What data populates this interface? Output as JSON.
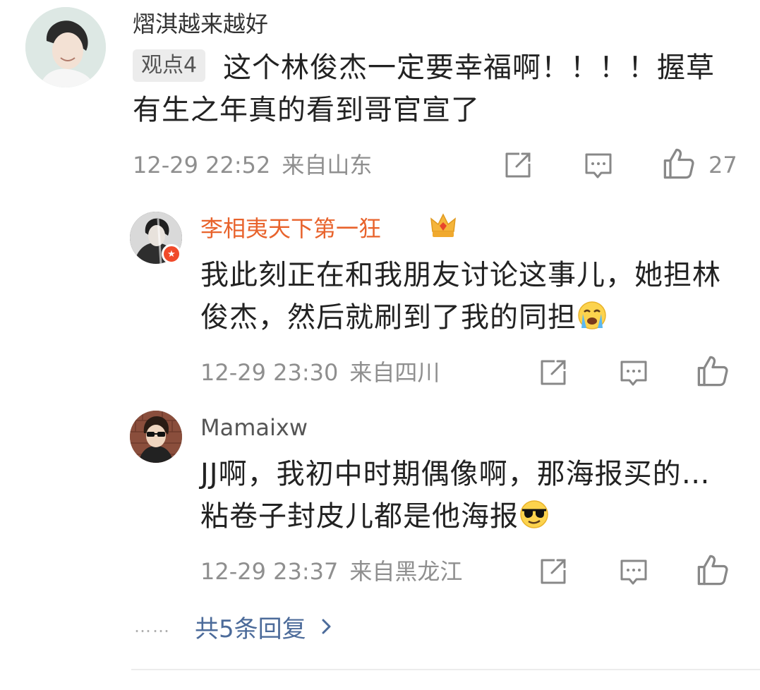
{
  "comment": {
    "username": "熠淇越来越好",
    "tag": "观点4",
    "text": "这个林俊杰一定要幸福啊！！！！握草有生之年真的看到哥官宣了",
    "time": "12-29 22:52",
    "location": "来自山东",
    "like_count": "27"
  },
  "replies": [
    {
      "username": "李相夷天下第一狂",
      "text": "我此刻正在和我朋友讨论这事儿，她担林俊杰，然后就刷到了我的同担",
      "emoji": "crying-face",
      "time": "12-29 23:30",
      "location": "来自四川"
    },
    {
      "username": "Mamaixw",
      "text": "JJ啊，我初中时期偶像啊，那海报买的…粘卷子封皮儿都是他海报",
      "emoji": "sunglasses-face",
      "time": "12-29 23:37",
      "location": "来自黑龙江"
    }
  ],
  "more_replies": {
    "dots": "……",
    "label": "共5条回复"
  },
  "icons": {
    "share": "share-icon",
    "reply": "comment-icon",
    "like": "thumbs-up-icon",
    "crown": "crown-icon",
    "badge": "vip-badge-icon"
  },
  "colors": {
    "highlight_username": "#e8632c",
    "link": "#4c6b9a",
    "meta": "#8f8f8f"
  }
}
